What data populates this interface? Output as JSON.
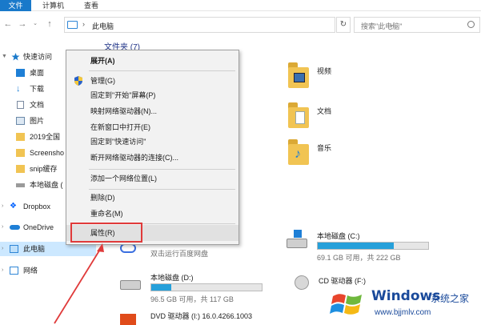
{
  "ribbon": {
    "tabs": [
      "文件",
      "计算机",
      "查看"
    ]
  },
  "address": {
    "location": "此电脑",
    "search_placeholder": "搜索\"此电脑\""
  },
  "nav": {
    "items": [
      {
        "label": "快速访问",
        "icon": "star-icon"
      },
      {
        "label": "桌面",
        "icon": "desktop-icon"
      },
      {
        "label": "下载",
        "icon": "download-icon"
      },
      {
        "label": "文档",
        "icon": "document-icon"
      },
      {
        "label": "图片",
        "icon": "picture-icon"
      },
      {
        "label": "2019全国",
        "icon": "folder-icon"
      },
      {
        "label": "Screensho",
        "icon": "folder-icon"
      },
      {
        "label": "snip缓存",
        "icon": "folder-icon"
      },
      {
        "label": "本地磁盘 (",
        "icon": "drive-icon"
      },
      {
        "label": "Dropbox",
        "icon": "dropbox-icon"
      },
      {
        "label": "OneDrive",
        "icon": "cloud-icon"
      },
      {
        "label": "此电脑",
        "icon": "computer-icon"
      },
      {
        "label": "网络",
        "icon": "network-icon"
      }
    ]
  },
  "content": {
    "folders_header": "文件夹 (7)",
    "folders": [
      {
        "label": "视频",
        "icon": "video-folder-icon"
      },
      {
        "label": "文档",
        "icon": "document-folder-icon"
      },
      {
        "label": "音乐",
        "icon": "music-folder-icon"
      }
    ],
    "drives": [
      {
        "name": "本地磁盘 (C:)",
        "free": "69.1 GB 可用，共 222 GB",
        "used_fraction": 0.69,
        "icon": "windows-drive-icon"
      },
      {
        "name": "双击运行百度网盘",
        "free": "",
        "used_fraction": null,
        "icon": "baidu-netdisk-icon"
      },
      {
        "name": "本地磁盘 (D:)",
        "free": "96.5 GB 可用，共 117 GB",
        "used_fraction": 0.18,
        "icon": "drive-icon"
      },
      {
        "name": "CD 驱动器 (F:)",
        "free": "",
        "used_fraction": null,
        "icon": "cd-drive-icon"
      },
      {
        "name": "DVD 驱动器 (I:) 16.0.4266.1003",
        "free": "",
        "used_fraction": null,
        "icon": "office-dvd-icon"
      }
    ]
  },
  "context_menu": {
    "items": [
      {
        "label": "展开(A)",
        "bold": true
      },
      {
        "label": "管理(G)",
        "icon": "shield-icon"
      },
      {
        "label": "固定到\"开始\"屏幕(P)"
      },
      {
        "label": "映射网络驱动器(N)..."
      },
      {
        "label": "在新窗口中打开(E)"
      },
      {
        "label": "固定到\"快速访问\""
      },
      {
        "label": "断开网络驱动器的连接(C)..."
      },
      {
        "label": "添加一个网络位置(L)"
      },
      {
        "label": "删除(D)"
      },
      {
        "label": "重命名(M)"
      },
      {
        "label": "属性(R)",
        "highlighted": true
      }
    ]
  },
  "watermark": {
    "title": "Windows",
    "subtitle": "系统之家",
    "url": "www.bjjmlv.com"
  },
  "colors": {
    "accent": "#1979ca",
    "highlight_box": "#e03a3a",
    "selected": "#cce8ff",
    "drive_fill": "#26a0da"
  }
}
